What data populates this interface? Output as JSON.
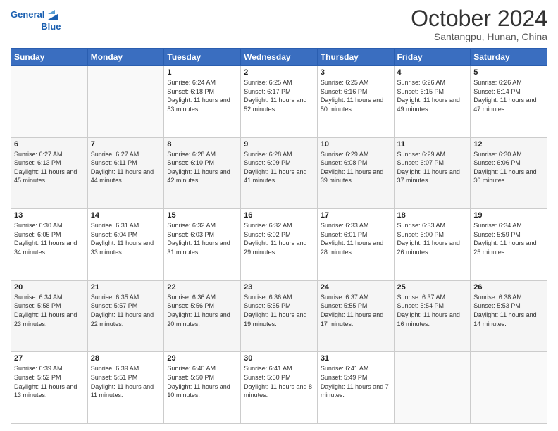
{
  "logo": {
    "line1": "General",
    "line2": "Blue"
  },
  "title": "October 2024",
  "location": "Santangpu, Hunan, China",
  "headers": [
    "Sunday",
    "Monday",
    "Tuesday",
    "Wednesday",
    "Thursday",
    "Friday",
    "Saturday"
  ],
  "weeks": [
    [
      {
        "day": "",
        "info": ""
      },
      {
        "day": "",
        "info": ""
      },
      {
        "day": "1",
        "info": "Sunrise: 6:24 AM\nSunset: 6:18 PM\nDaylight: 11 hours and 53 minutes."
      },
      {
        "day": "2",
        "info": "Sunrise: 6:25 AM\nSunset: 6:17 PM\nDaylight: 11 hours and 52 minutes."
      },
      {
        "day": "3",
        "info": "Sunrise: 6:25 AM\nSunset: 6:16 PM\nDaylight: 11 hours and 50 minutes."
      },
      {
        "day": "4",
        "info": "Sunrise: 6:26 AM\nSunset: 6:15 PM\nDaylight: 11 hours and 49 minutes."
      },
      {
        "day": "5",
        "info": "Sunrise: 6:26 AM\nSunset: 6:14 PM\nDaylight: 11 hours and 47 minutes."
      }
    ],
    [
      {
        "day": "6",
        "info": "Sunrise: 6:27 AM\nSunset: 6:13 PM\nDaylight: 11 hours and 45 minutes."
      },
      {
        "day": "7",
        "info": "Sunrise: 6:27 AM\nSunset: 6:11 PM\nDaylight: 11 hours and 44 minutes."
      },
      {
        "day": "8",
        "info": "Sunrise: 6:28 AM\nSunset: 6:10 PM\nDaylight: 11 hours and 42 minutes."
      },
      {
        "day": "9",
        "info": "Sunrise: 6:28 AM\nSunset: 6:09 PM\nDaylight: 11 hours and 41 minutes."
      },
      {
        "day": "10",
        "info": "Sunrise: 6:29 AM\nSunset: 6:08 PM\nDaylight: 11 hours and 39 minutes."
      },
      {
        "day": "11",
        "info": "Sunrise: 6:29 AM\nSunset: 6:07 PM\nDaylight: 11 hours and 37 minutes."
      },
      {
        "day": "12",
        "info": "Sunrise: 6:30 AM\nSunset: 6:06 PM\nDaylight: 11 hours and 36 minutes."
      }
    ],
    [
      {
        "day": "13",
        "info": "Sunrise: 6:30 AM\nSunset: 6:05 PM\nDaylight: 11 hours and 34 minutes."
      },
      {
        "day": "14",
        "info": "Sunrise: 6:31 AM\nSunset: 6:04 PM\nDaylight: 11 hours and 33 minutes."
      },
      {
        "day": "15",
        "info": "Sunrise: 6:32 AM\nSunset: 6:03 PM\nDaylight: 11 hours and 31 minutes."
      },
      {
        "day": "16",
        "info": "Sunrise: 6:32 AM\nSunset: 6:02 PM\nDaylight: 11 hours and 29 minutes."
      },
      {
        "day": "17",
        "info": "Sunrise: 6:33 AM\nSunset: 6:01 PM\nDaylight: 11 hours and 28 minutes."
      },
      {
        "day": "18",
        "info": "Sunrise: 6:33 AM\nSunset: 6:00 PM\nDaylight: 11 hours and 26 minutes."
      },
      {
        "day": "19",
        "info": "Sunrise: 6:34 AM\nSunset: 5:59 PM\nDaylight: 11 hours and 25 minutes."
      }
    ],
    [
      {
        "day": "20",
        "info": "Sunrise: 6:34 AM\nSunset: 5:58 PM\nDaylight: 11 hours and 23 minutes."
      },
      {
        "day": "21",
        "info": "Sunrise: 6:35 AM\nSunset: 5:57 PM\nDaylight: 11 hours and 22 minutes."
      },
      {
        "day": "22",
        "info": "Sunrise: 6:36 AM\nSunset: 5:56 PM\nDaylight: 11 hours and 20 minutes."
      },
      {
        "day": "23",
        "info": "Sunrise: 6:36 AM\nSunset: 5:55 PM\nDaylight: 11 hours and 19 minutes."
      },
      {
        "day": "24",
        "info": "Sunrise: 6:37 AM\nSunset: 5:55 PM\nDaylight: 11 hours and 17 minutes."
      },
      {
        "day": "25",
        "info": "Sunrise: 6:37 AM\nSunset: 5:54 PM\nDaylight: 11 hours and 16 minutes."
      },
      {
        "day": "26",
        "info": "Sunrise: 6:38 AM\nSunset: 5:53 PM\nDaylight: 11 hours and 14 minutes."
      }
    ],
    [
      {
        "day": "27",
        "info": "Sunrise: 6:39 AM\nSunset: 5:52 PM\nDaylight: 11 hours and 13 minutes."
      },
      {
        "day": "28",
        "info": "Sunrise: 6:39 AM\nSunset: 5:51 PM\nDaylight: 11 hours and 11 minutes."
      },
      {
        "day": "29",
        "info": "Sunrise: 6:40 AM\nSunset: 5:50 PM\nDaylight: 11 hours and 10 minutes."
      },
      {
        "day": "30",
        "info": "Sunrise: 6:41 AM\nSunset: 5:50 PM\nDaylight: 11 hours and 8 minutes."
      },
      {
        "day": "31",
        "info": "Sunrise: 6:41 AM\nSunset: 5:49 PM\nDaylight: 11 hours and 7 minutes."
      },
      {
        "day": "",
        "info": ""
      },
      {
        "day": "",
        "info": ""
      }
    ]
  ]
}
